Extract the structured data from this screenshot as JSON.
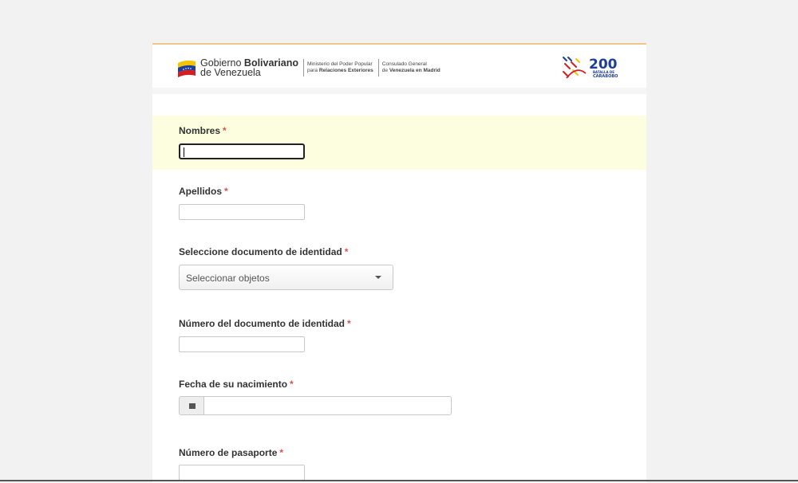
{
  "header": {
    "gov_line1": "Gobierno",
    "gov_line1_bold": "Bolivariano",
    "gov_line2": "de Venezuela",
    "ministry_line1": "Ministerio del Poder Popular",
    "ministry_line2_prefix": "para",
    "ministry_line2_bold": "Relaciones Exteriores",
    "consulate_line1": "Consulado General",
    "consulate_line2_prefix": "de",
    "consulate_line2_bold": "Venezuela en Madrid",
    "badge_number": "200",
    "badge_line1": "BATALLA DE",
    "badge_line2": "CARABOBO"
  },
  "form": {
    "nombres": {
      "label": "Nombres",
      "required": "*",
      "value": ""
    },
    "apellidos": {
      "label": "Apellidos",
      "required": "*",
      "value": ""
    },
    "documento": {
      "label": "Seleccione documento de identidad",
      "required": "*",
      "placeholder": "Seleccionar objetos"
    },
    "numero_documento": {
      "label": "Número del documento de identidad",
      "required": "*",
      "value": ""
    },
    "fecha_nacimiento": {
      "label": "Fecha de su nacimiento",
      "required": "*",
      "value": ""
    },
    "pasaporte": {
      "label": "Número de pasaporte",
      "required": "*",
      "value": ""
    }
  },
  "colors": {
    "highlight": "#fdfde0",
    "required": "#d9534f",
    "banner_top_border": "#f2c58a"
  },
  "icons": [
    "venezuela-flag-icon",
    "bicentenario-logo-icon",
    "calendar-icon",
    "chevron-down-icon"
  ]
}
